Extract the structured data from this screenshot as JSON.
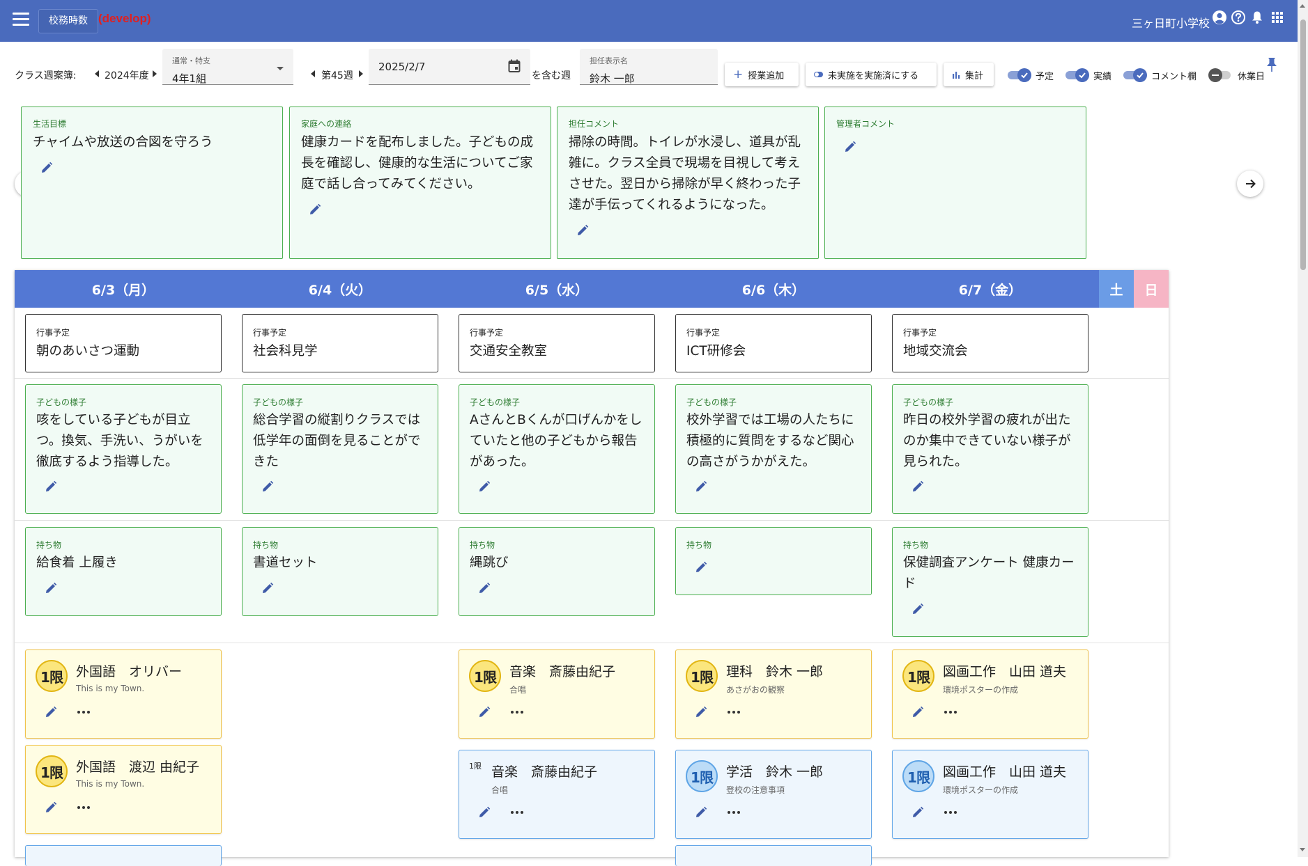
{
  "appbar": {
    "title": "校務時数",
    "env": "(develop)",
    "school": "三ヶ日町小学校"
  },
  "toolbar": {
    "class_label": "クラス週案簿:",
    "year": "2024年度",
    "class_field": {
      "label": "通常・特支",
      "value": "4年1組"
    },
    "week": "第45週",
    "date_value": "2025/2/7",
    "includes_label": "を含む週",
    "teacher_field": {
      "label": "担任表示名",
      "value": "鈴木 一郎"
    },
    "buttons": {
      "add_class": "授業追加",
      "mark_done": "未実施を実施済にする",
      "summary": "集計"
    },
    "toggles": [
      {
        "label": "予定",
        "on": true
      },
      {
        "label": "実績",
        "on": true
      },
      {
        "label": "コメント欄",
        "on": true
      },
      {
        "label": "休業日",
        "on": false
      }
    ]
  },
  "top_cards": [
    {
      "title": "生活目標",
      "body": "チャイムや放送の合図を守ろう"
    },
    {
      "title": "家庭への連絡",
      "body": "健康カードを配布しました。子どもの成長を確認し、健康的な生活についてご家庭で話し合ってみてください。"
    },
    {
      "title": "担任コメント",
      "body": "掃除の時間。トイレが水浸し、道具が乱雑に。クラス全員で現場を目視して考えさせた。翌日から掃除が早く終わった子達が手伝ってくれるようになった。"
    },
    {
      "title": "管理者コメント",
      "body": ""
    }
  ],
  "days": [
    "6/3（月）",
    "6/4（火）",
    "6/5（水）",
    "6/6（木）",
    "6/7（金）"
  ],
  "weekend": {
    "sat": "土",
    "sun": "日"
  },
  "events": [
    {
      "title": "行事予定",
      "body": "朝のあいさつ運動"
    },
    {
      "title": "行事予定",
      "body": "社会科見学"
    },
    {
      "title": "行事予定",
      "body": "交通安全教室"
    },
    {
      "title": "行事予定",
      "body": "ICT研修会"
    },
    {
      "title": "行事予定",
      "body": "地域交流会"
    }
  ],
  "children": [
    {
      "title": "子どもの様子",
      "body": "咳をしている子どもが目立つ。換気、手洗い、うがいを徹底するよう指導した。"
    },
    {
      "title": "子どもの様子",
      "body": "総合学習の縦割りクラスでは低学年の面倒を見ることができた"
    },
    {
      "title": "子どもの様子",
      "body": "AさんとBくんが口げんかをしていたと他の子どもから報告があった。"
    },
    {
      "title": "子どもの様子",
      "body": "校外学習では工場の人たちに積極的に質問をするなど関心の高さがうかがえた。"
    },
    {
      "title": "子どもの様子",
      "body": "昨日の校外学習の疲れが出たのか集中できていない様子が見られた。"
    }
  ],
  "belongings": [
    {
      "title": "持ち物",
      "body": "給食着 上履き"
    },
    {
      "title": "持ち物",
      "body": "書道セット"
    },
    {
      "title": "持ち物",
      "body": "縄跳び"
    },
    {
      "title": "持ち物",
      "body": ""
    },
    {
      "title": "持ち物",
      "body": "保健調査アンケート 健康カード"
    }
  ],
  "lessons": {
    "period_label": "1限",
    "cards": [
      {
        "id": "mon-1",
        "subject": "外国語　オリバー",
        "note": "This is my Town."
      },
      {
        "id": "mon-2",
        "subject": "外国語　渡辺 由紀子",
        "note": "This is my Town."
      },
      {
        "id": "wed-1",
        "subject": "音楽　斎藤由紀子",
        "note": "合唱"
      },
      {
        "id": "wed-2",
        "subject": "音楽　斎藤由紀子",
        "note": "合唱"
      },
      {
        "id": "thu-1",
        "subject": "理科　鈴木 一郎",
        "note": "あさがおの観察"
      },
      {
        "id": "thu-2",
        "subject": "学活　鈴木 一郎",
        "note": "登校の注意事項"
      },
      {
        "id": "fri-1",
        "subject": "図画工作　山田 道夫",
        "note": "環境ポスターの作成"
      },
      {
        "id": "fri-2",
        "subject": "図画工作　山田 道夫",
        "note": "環境ポスターの作成"
      }
    ]
  },
  "colors": {
    "appbar": "#4a6bbd",
    "grid_header": "#5378d4",
    "saturday": "#6b9ce6",
    "sunday": "#f6b5c5",
    "green_card_border": "#4caf50",
    "yellow_card_border": "#f0c34a",
    "blue_card_border": "#64a7e8"
  },
  "icons": [
    "menu-icon",
    "account-icon",
    "help-icon",
    "bell-icon",
    "apps-icon",
    "calendar-icon",
    "pin-icon",
    "pencil-icon",
    "more-icon",
    "arrow-left-icon",
    "arrow-right-icon",
    "plus-icon",
    "toggle-icon",
    "bar-chart-icon",
    "check-icon"
  ]
}
